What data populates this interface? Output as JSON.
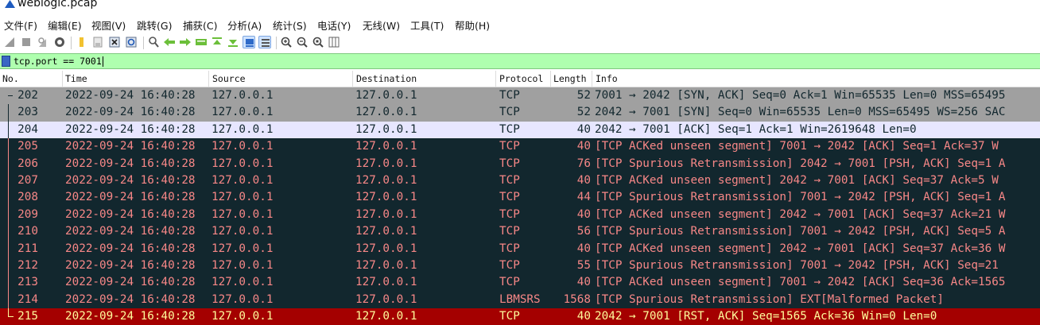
{
  "window": {
    "title": "weblogic.pcap"
  },
  "menu": [
    "文件(F)",
    "编辑(E)",
    "视图(V)",
    "跳转(G)",
    "捕获(C)",
    "分析(A)",
    "统计(S)",
    "电话(Y)",
    "无线(W)",
    "工具(T)",
    "帮助(H)"
  ],
  "toolbar_icons": [
    "shark-fin-start-icon",
    "stop-square-icon",
    "restart-fin-icon",
    "gear-options-icon",
    "open-folder-icon",
    "file-save-icon",
    "close-file-icon",
    "reload-icon",
    "find-magnifier-icon",
    "go-back-arrow-icon",
    "go-forward-arrow-icon",
    "go-to-packet-icon",
    "go-first-icon",
    "go-last-icon",
    "autoscroll-icon",
    "colorize-icon",
    "zoom-in-icon",
    "zoom-out-icon",
    "zoom-normal-icon",
    "resize-columns-icon"
  ],
  "filter": {
    "value": "tcp.port == 7001"
  },
  "columns": {
    "no": "No.",
    "time": "Time",
    "source": "Source",
    "destination": "Destination",
    "protocol": "Protocol",
    "length": "Length",
    "info": "Info"
  },
  "colors": {
    "row_gray_bg": "#a0a0a0",
    "row_gray_fg": "#12272e",
    "row_selected_bg": "#e7e6ff",
    "row_selected_fg": "#12272e",
    "row_dark_bg": "#12272e",
    "row_dark_fg": "#f78787",
    "row_red_bg": "#a40000",
    "row_red_fg": "#fffc9c"
  },
  "packets": [
    {
      "no": "202",
      "time": "2022-09-24 16:40:28",
      "src": "127.0.0.1",
      "dst": "127.0.0.1",
      "proto": "TCP",
      "len": "52",
      "info": "7001 → 2042 [SYN, ACK] Seq=0 Ack=1 Win=65535 Len=0 MSS=65495",
      "style": "gray"
    },
    {
      "no": "203",
      "time": "2022-09-24 16:40:28",
      "src": "127.0.0.1",
      "dst": "127.0.0.1",
      "proto": "TCP",
      "len": "52",
      "info": "2042 → 7001 [SYN] Seq=0 Win=65535 Len=0 MSS=65495 WS=256 SAC",
      "style": "gray"
    },
    {
      "no": "204",
      "time": "2022-09-24 16:40:28",
      "src": "127.0.0.1",
      "dst": "127.0.0.1",
      "proto": "TCP",
      "len": "40",
      "info": "2042 → 7001 [ACK] Seq=1 Ack=1 Win=2619648 Len=0",
      "style": "selected"
    },
    {
      "no": "205",
      "time": "2022-09-24 16:40:28",
      "src": "127.0.0.1",
      "dst": "127.0.0.1",
      "proto": "TCP",
      "len": "40",
      "info": "[TCP ACKed unseen segment] 7001 → 2042 [ACK] Seq=1 Ack=37 W",
      "style": "dark"
    },
    {
      "no": "206",
      "time": "2022-09-24 16:40:28",
      "src": "127.0.0.1",
      "dst": "127.0.0.1",
      "proto": "TCP",
      "len": "76",
      "info": "[TCP Spurious Retransmission] 2042 → 7001 [PSH, ACK] Seq=1 A",
      "style": "dark"
    },
    {
      "no": "207",
      "time": "2022-09-24 16:40:28",
      "src": "127.0.0.1",
      "dst": "127.0.0.1",
      "proto": "TCP",
      "len": "40",
      "info": "[TCP ACKed unseen segment] 2042 → 7001 [ACK] Seq=37 Ack=5 W",
      "style": "dark"
    },
    {
      "no": "208",
      "time": "2022-09-24 16:40:28",
      "src": "127.0.0.1",
      "dst": "127.0.0.1",
      "proto": "TCP",
      "len": "44",
      "info": "[TCP Spurious Retransmission] 7001 → 2042 [PSH, ACK] Seq=1 A",
      "style": "dark"
    },
    {
      "no": "209",
      "time": "2022-09-24 16:40:28",
      "src": "127.0.0.1",
      "dst": "127.0.0.1",
      "proto": "TCP",
      "len": "40",
      "info": "[TCP ACKed unseen segment] 2042 → 7001 [ACK] Seq=37 Ack=21 W",
      "style": "dark"
    },
    {
      "no": "210",
      "time": "2022-09-24 16:40:28",
      "src": "127.0.0.1",
      "dst": "127.0.0.1",
      "proto": "TCP",
      "len": "56",
      "info": "[TCP Spurious Retransmission] 7001 → 2042 [PSH, ACK] Seq=5 A",
      "style": "dark"
    },
    {
      "no": "211",
      "time": "2022-09-24 16:40:28",
      "src": "127.0.0.1",
      "dst": "127.0.0.1",
      "proto": "TCP",
      "len": "40",
      "info": "[TCP ACKed unseen segment] 2042 → 7001 [ACK] Seq=37 Ack=36 W",
      "style": "dark"
    },
    {
      "no": "212",
      "time": "2022-09-24 16:40:28",
      "src": "127.0.0.1",
      "dst": "127.0.0.1",
      "proto": "TCP",
      "len": "55",
      "info": "[TCP Spurious Retransmission] 7001 → 2042 [PSH, ACK] Seq=21",
      "style": "dark"
    },
    {
      "no": "213",
      "time": "2022-09-24 16:40:28",
      "src": "127.0.0.1",
      "dst": "127.0.0.1",
      "proto": "TCP",
      "len": "40",
      "info": "[TCP ACKed unseen segment] 7001 → 2042 [ACK] Seq=36 Ack=1565",
      "style": "dark"
    },
    {
      "no": "214",
      "time": "2022-09-24 16:40:28",
      "src": "127.0.0.1",
      "dst": "127.0.0.1",
      "proto": "LBMSRS",
      "len": "1568",
      "info": "[TCP Spurious Retransmission] EXT[Malformed Packet]",
      "style": "dark"
    },
    {
      "no": "215",
      "time": "2022-09-24 16:40:28",
      "src": "127.0.0.1",
      "dst": "127.0.0.1",
      "proto": "TCP",
      "len": "40",
      "info": "2042 → 7001 [RST, ACK] Seq=1565 Ack=36 Win=0 Len=0",
      "style": "red"
    }
  ]
}
